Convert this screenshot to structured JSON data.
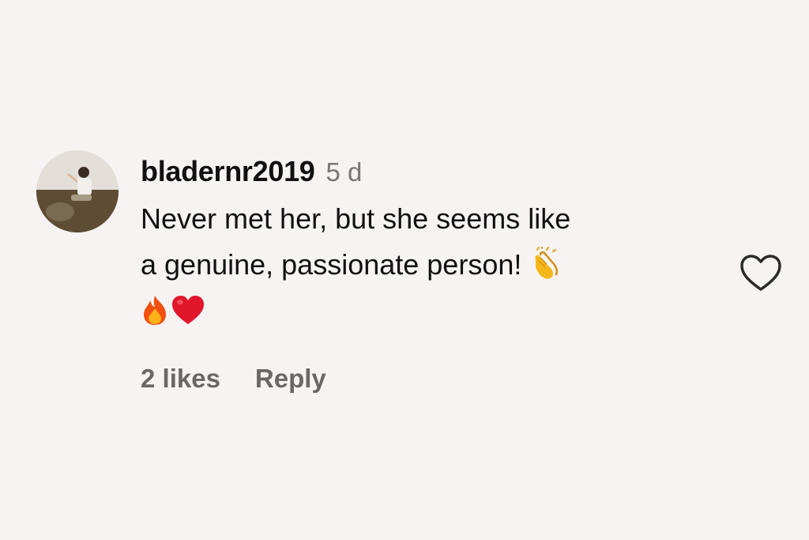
{
  "comment": {
    "username": "bladernr2019",
    "timestamp": "5 d",
    "text_line1": "Never met her, but she seems like",
    "text_line2": "a genuine, passionate person!",
    "emojis": [
      "clapping-hands",
      "fire",
      "red-heart"
    ]
  },
  "actions": {
    "likes_label": "2 likes",
    "reply_label": "Reply"
  },
  "icons": {
    "like": "heart-outline-icon",
    "avatar": "user-avatar"
  },
  "colors": {
    "background": "#f7f3f3",
    "text_primary": "#111111",
    "text_secondary": "#6b6767",
    "timestamp": "#7a7676"
  }
}
